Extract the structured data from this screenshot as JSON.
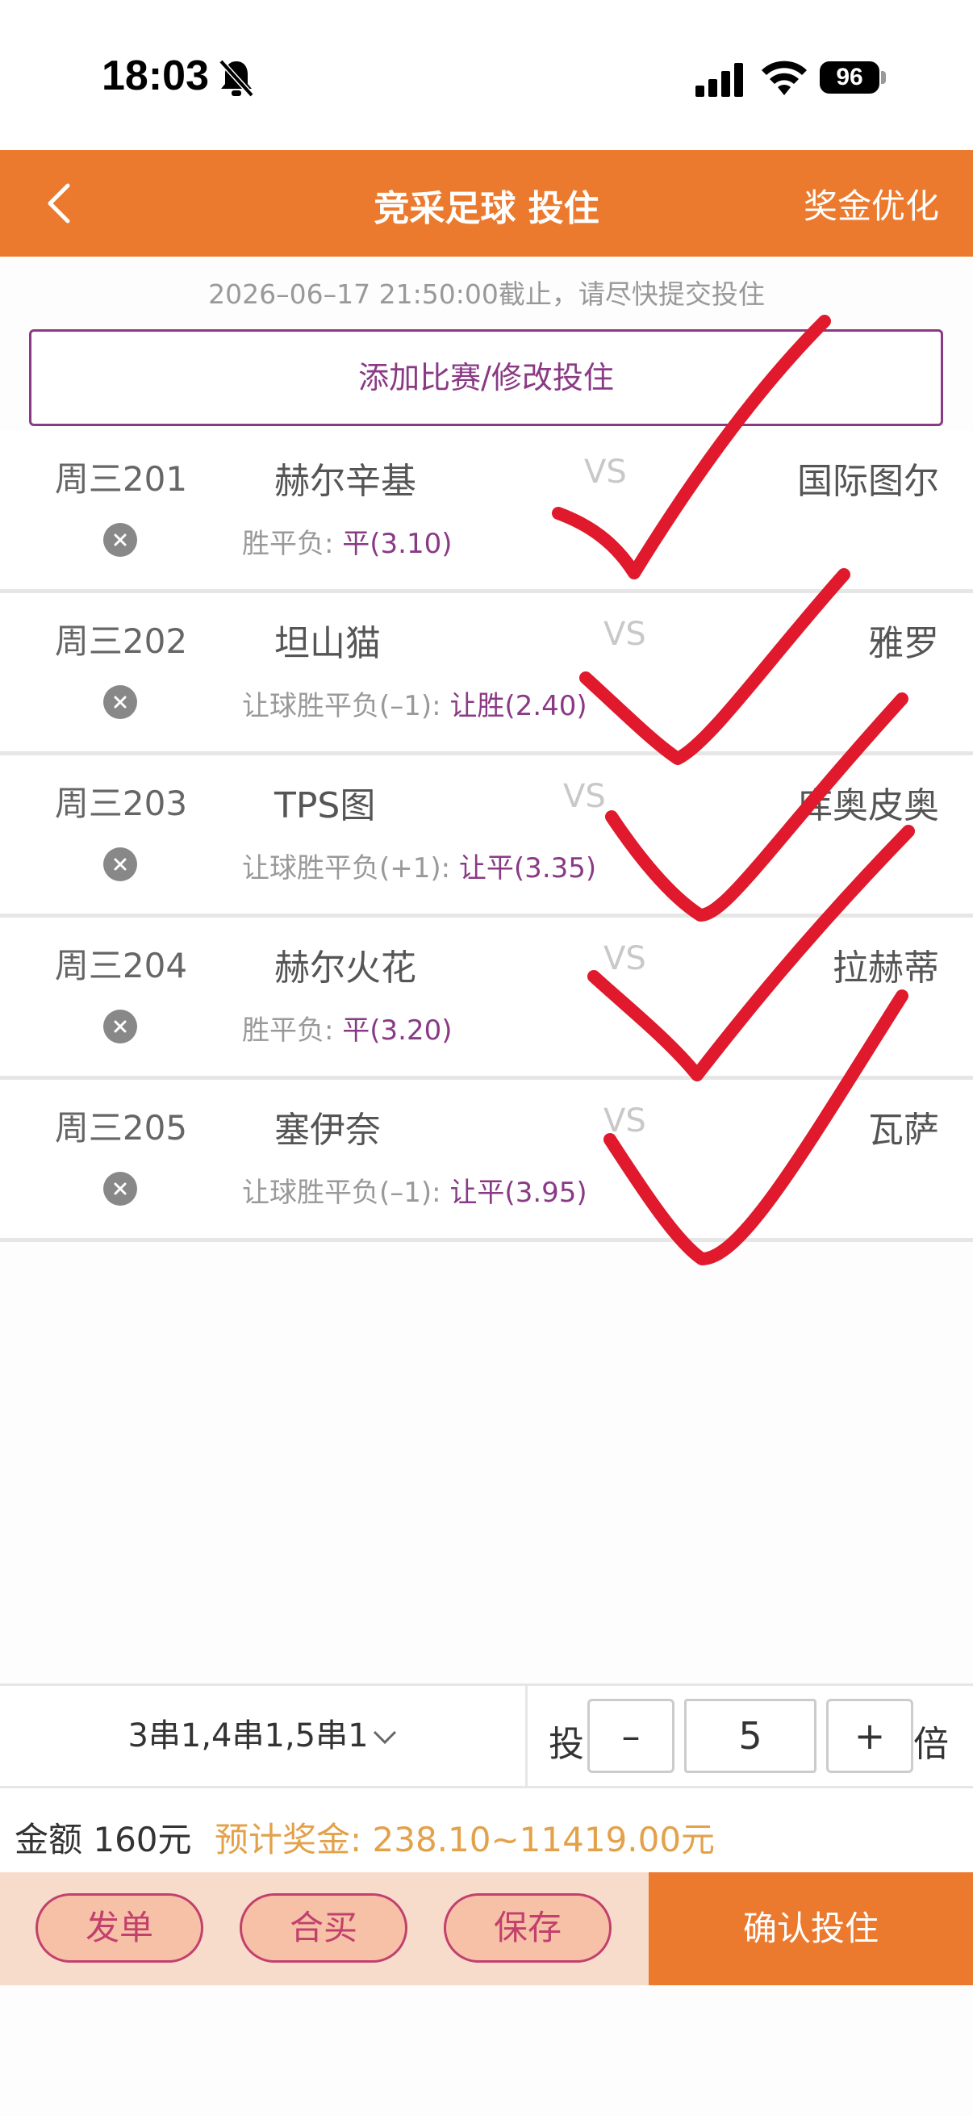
{
  "status_bar": {
    "time": "18:03",
    "battery": "96"
  },
  "header": {
    "title": "竞采足球 投住",
    "action": "奖金优化"
  },
  "deadline_text": "2026–06–17 21:50:00截止，请尽快提交投住",
  "add_match_label": "添加比赛/修改投住",
  "matches": [
    {
      "no": "周三201",
      "home": "赫尔辛基",
      "vs": "VS",
      "away": "国际图尔",
      "bet_type": "胜平负: ",
      "pick": "平(3.10)"
    },
    {
      "no": "周三202",
      "home": "坦山猫",
      "vs": "VS",
      "away": "雅罗",
      "bet_type": "让球胜平负(–1): ",
      "pick": "让胜(2.40)"
    },
    {
      "no": "周三203",
      "home": "TPS图",
      "vs": "VS",
      "away": "库奥皮奥",
      "bet_type": "让球胜平负(+1): ",
      "pick": "让平(3.35)"
    },
    {
      "no": "周三204",
      "home": "赫尔火花",
      "vs": "VS",
      "away": "拉赫蒂",
      "bet_type": "胜平负: ",
      "pick": "平(3.20)"
    },
    {
      "no": "周三205",
      "home": "塞伊奈",
      "vs": "VS",
      "away": "瓦萨",
      "bet_type": "让球胜平负(–1): ",
      "pick": "让平(3.95)"
    }
  ],
  "play": {
    "selection": "3串1,4串1,5串1"
  },
  "multiplier": {
    "prefix": "投",
    "minus": "–",
    "value": "5",
    "plus": "+",
    "suffix": "倍"
  },
  "amount": {
    "label": "金额 160元",
    "prize": "预计奖金: 238.10~11419.00元"
  },
  "actions": {
    "issue": "发单",
    "group_buy": "合买",
    "save": "保存",
    "confirm": "确认投住"
  },
  "colors": {
    "brand_orange": "#ec7a2e",
    "accent_purple": "#8a3a85",
    "check_red": "#e0192c",
    "prize_gold": "#e3a14a"
  },
  "icons": {
    "back": "chevron-left-icon",
    "remove": "close-circle-icon",
    "bell": "bell-slash-icon",
    "dropdown": "chevron-down-icon"
  }
}
